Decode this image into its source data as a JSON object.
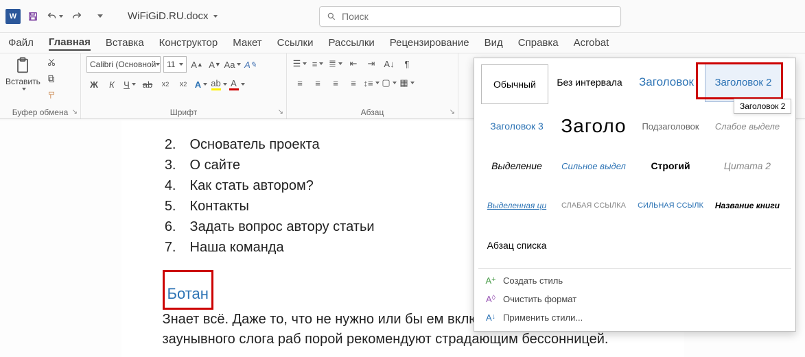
{
  "titlebar": {
    "doc_name": "WiFiGiD.RU.docx",
    "search_placeholder": "Поиск"
  },
  "tabs": [
    "Файл",
    "Главная",
    "Вставка",
    "Конструктор",
    "Макет",
    "Ссылки",
    "Рассылки",
    "Рецензирование",
    "Вид",
    "Справка",
    "Acrobat"
  ],
  "active_tab_index": 1,
  "groups": {
    "clipboard": {
      "paste": "Вставить",
      "label": "Буфер обмена"
    },
    "font": {
      "name": "Calibri (Основной",
      "size": "11",
      "label": "Шрифт"
    },
    "paragraph": {
      "label": "Абзац"
    }
  },
  "styles": {
    "cells": [
      {
        "text": "Обычный",
        "css": "font-size:14px;"
      },
      {
        "text": "Без интервала",
        "css": "font-size:14px;"
      },
      {
        "text": "Заголовок",
        "css": "color:#2E74B5;font-size:17px;"
      },
      {
        "text": "Заголовок 2",
        "css": "color:#2E74B5;font-size:15px;"
      },
      {
        "text": "Заголовок 3",
        "css": "color:#2E74B5;font-size:14px;"
      },
      {
        "text": "Заголо",
        "css": "font-size:28px;letter-spacing:1px;"
      },
      {
        "text": "Подзаголовок",
        "css": "color:#666;font-size:13px;"
      },
      {
        "text": "Слабое выделе",
        "css": "color:#888;font-style:italic;font-size:13px;"
      },
      {
        "text": "Выделение",
        "css": "font-style:italic;font-size:14px;"
      },
      {
        "text": "Сильное выдел",
        "css": "color:#2E74B5;font-style:italic;font-size:13px;"
      },
      {
        "text": "Строгий",
        "css": "font-weight:bold;font-size:14px;"
      },
      {
        "text": "Цитата 2",
        "css": "color:#888;font-style:italic;font-size:14px;"
      },
      {
        "text": "Выделенная ци",
        "css": "color:#2E74B5;font-style:italic;text-decoration:underline;font-size:12px;"
      },
      {
        "text": "СЛАБАЯ ССЫЛКА",
        "css": "color:#888;font-size:11px;letter-spacing:0px;"
      },
      {
        "text": "СИЛЬНАЯ ССЫЛК",
        "css": "color:#2E74B5;font-size:11px;"
      },
      {
        "text": "Название книги",
        "css": "font-style:italic;font-weight:bold;font-size:12px;"
      },
      {
        "text": "Абзац списка",
        "css": "font-size:14px;"
      }
    ],
    "hover_index": 3,
    "tooltip": "Заголовок 2",
    "actions": {
      "create": "Создать стиль",
      "clear": "Очистить формат",
      "apply": "Применить стили..."
    }
  },
  "document": {
    "list_start": 2,
    "items": [
      "Основатель проекта",
      "О сайте",
      "Как стать автором?",
      "Контакты",
      "Задать вопрос автору статьи",
      "Наша команда"
    ],
    "heading2": "Ботан",
    "paragraph": "Знает всё. Даже то, что не нужно или бы                                               ем включая и этот. Из-за заунывного слога                                              раб порой рекомендуют страдающим бессонницей."
  }
}
